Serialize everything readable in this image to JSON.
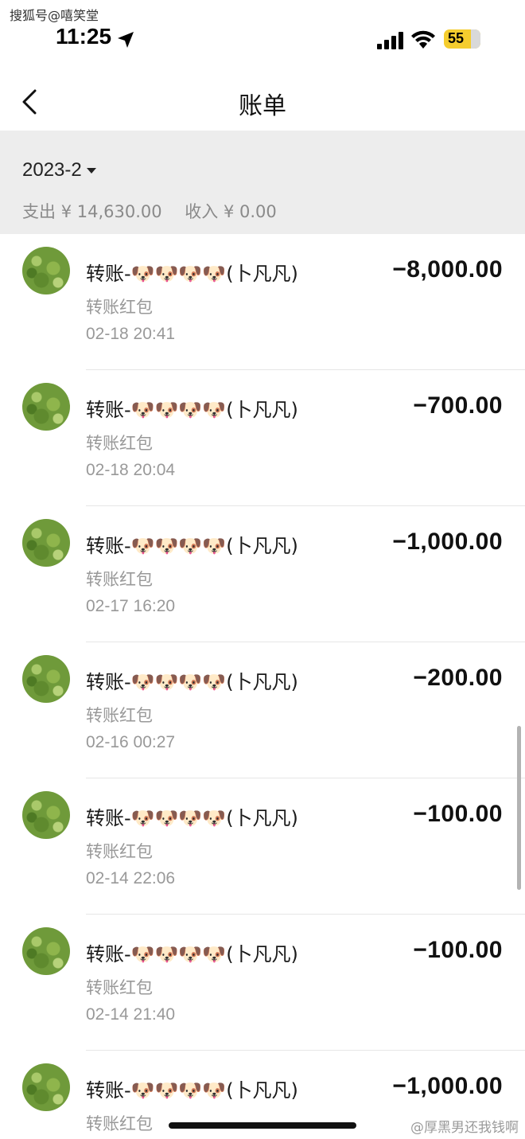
{
  "watermark_top": "搜狐号@嘻笑堂",
  "status_bar": {
    "time": "11:25",
    "battery": "55",
    "icons": [
      "location-arrow-icon",
      "cellular-signal-icon",
      "wifi-icon",
      "battery-icon"
    ]
  },
  "nav": {
    "back_icon": "chevron-left-icon",
    "title": "账单"
  },
  "summary": {
    "month": "2023-2",
    "expense_label": "支出",
    "expense_value": "¥ 14,630.00",
    "income_label": "收入",
    "income_value": "¥ 0.00"
  },
  "transactions": [
    {
      "title": "转账-🐶🐶🐶🐶(卜凡凡)",
      "subtitle": "转账红包",
      "time": "02-18  20:41",
      "amount": "−8,000.00"
    },
    {
      "title": "转账-🐶🐶🐶🐶(卜凡凡)",
      "subtitle": "转账红包",
      "time": "02-18  20:04",
      "amount": "−700.00"
    },
    {
      "title": "转账-🐶🐶🐶🐶(卜凡凡)",
      "subtitle": "转账红包",
      "time": "02-17  16:20",
      "amount": "−1,000.00"
    },
    {
      "title": "转账-🐶🐶🐶🐶(卜凡凡)",
      "subtitle": "转账红包",
      "time": "02-16  00:27",
      "amount": "−200.00"
    },
    {
      "title": "转账-🐶🐶🐶🐶(卜凡凡)",
      "subtitle": "转账红包",
      "time": "02-14  22:06",
      "amount": "−100.00"
    },
    {
      "title": "转账-🐶🐶🐶🐶(卜凡凡)",
      "subtitle": "转账红包",
      "time": "02-14  21:40",
      "amount": "−100.00"
    },
    {
      "title": "转账-🐶🐶🐶🐶(卜凡凡)",
      "subtitle": "转账红包",
      "time": "",
      "amount": "−1,000.00"
    }
  ],
  "watermark_bottom": "@厚黑男还我钱啊"
}
